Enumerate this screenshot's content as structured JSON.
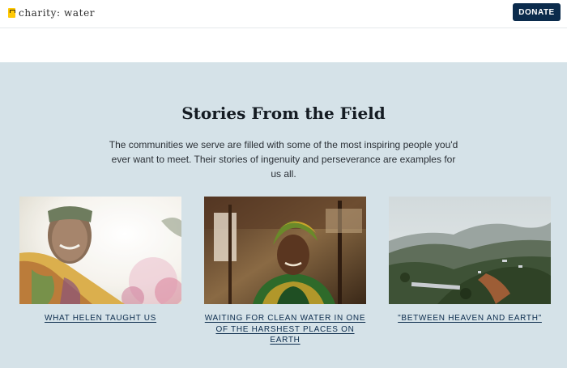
{
  "nav": {
    "logo_text": "charity: water",
    "logo_icon": "jerrycan-icon",
    "donate_label": "DONATE"
  },
  "stories": {
    "heading": "Stories From the Field",
    "intro": "The communities we serve are filled with some of the most inspiring people you'd ever want to meet. Their stories of ingenuity and perseverance are examples for us all.",
    "items": [
      {
        "title": "WHAT HELEN TAUGHT US",
        "image": "woman-smiling-photo"
      },
      {
        "title": "WAITING FOR CLEAN WATER IN ONE OF THE HARSHEST PLACES ON EARTH",
        "image": "woman-headscarf-photo"
      },
      {
        "title": "\"BETWEEN HEAVEN AND EARTH\"",
        "image": "hillside-village-photo"
      }
    ]
  },
  "colors": {
    "brand_yellow": "#ffc907",
    "navy": "#0b2b4c",
    "section_background": "#d5e2e8"
  }
}
